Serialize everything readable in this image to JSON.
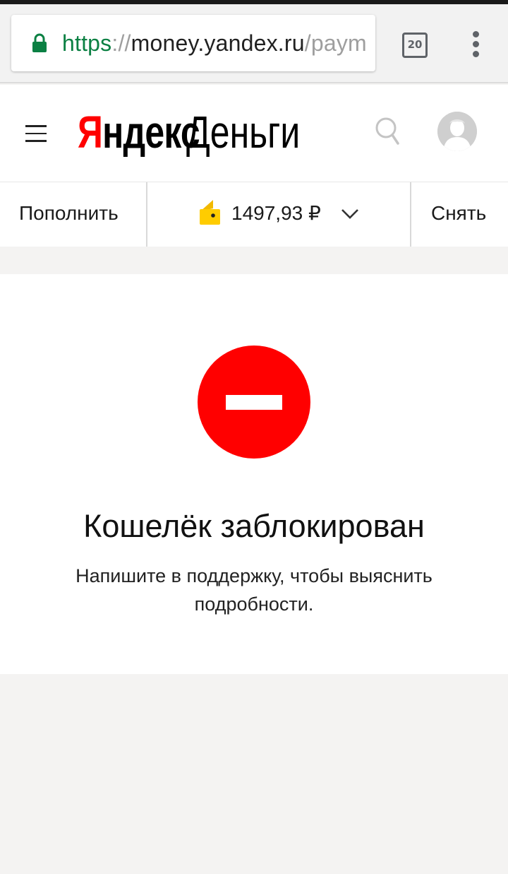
{
  "browser": {
    "url_scheme": "https",
    "url_separator": "://",
    "url_host": "money.yandex.ru",
    "url_path": "/paym",
    "tab_count": "20",
    "icons": [
      "lock-icon",
      "tabs-icon",
      "more-vert-icon"
    ],
    "colors": {
      "secure": "#0b8043"
    }
  },
  "header": {
    "logo_first_letter": "Я",
    "logo_rest": "ндекс",
    "logo_product": "Деньги",
    "icons": [
      "menu-icon",
      "search-icon",
      "avatar"
    ],
    "colors": {
      "brand_red": "#ff0000"
    }
  },
  "balance_bar": {
    "topup_label": "Пополнить",
    "balance": "1497,93 ₽",
    "withdraw_label": "Снять",
    "icons": [
      "wallet-icon",
      "chevron-down-icon"
    ],
    "colors": {
      "wallet": "#ffcc00"
    }
  },
  "main": {
    "title": "Кошелёк заблокирован",
    "description": "Напишите в поддержку, чтобы выяснить подробности.",
    "icon": "blocked-icon",
    "colors": {
      "blocked": "#ff0000"
    }
  }
}
